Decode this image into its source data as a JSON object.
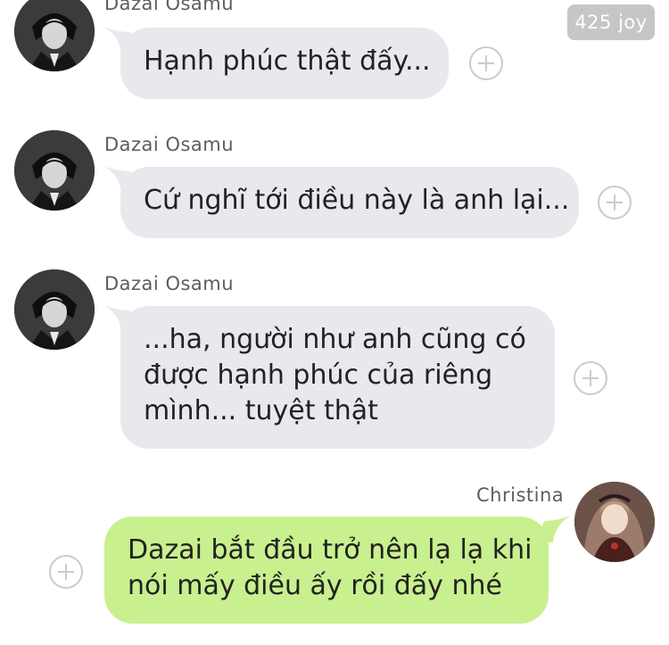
{
  "badge": {
    "text": "425 joy"
  },
  "messages": [
    {
      "sender": "Dazai Osamu",
      "text": "Hạnh phúc thật đấy..."
    },
    {
      "sender": "Dazai Osamu",
      "text": "Cứ nghĩ tới điều này là anh lại..."
    },
    {
      "sender": "Dazai Osamu",
      "lines": [
        "...ha, người như anh cũng có",
        "được hạnh phúc của riêng",
        "mình... tuyệt thật"
      ]
    },
    {
      "sender": "Christina",
      "lines": [
        "Dazai bắt đầu trở nên lạ lạ khi",
        "nói mấy điều ấy rồi đấy nhé"
      ]
    }
  ],
  "colors": {
    "incoming_bubble": "#e7e9ed",
    "outgoing_bubble": "#c9f08e",
    "badge": "#c6c6c6"
  },
  "icons": [
    "avatar-dazai",
    "avatar-christina",
    "add-reaction-plus-icon"
  ]
}
